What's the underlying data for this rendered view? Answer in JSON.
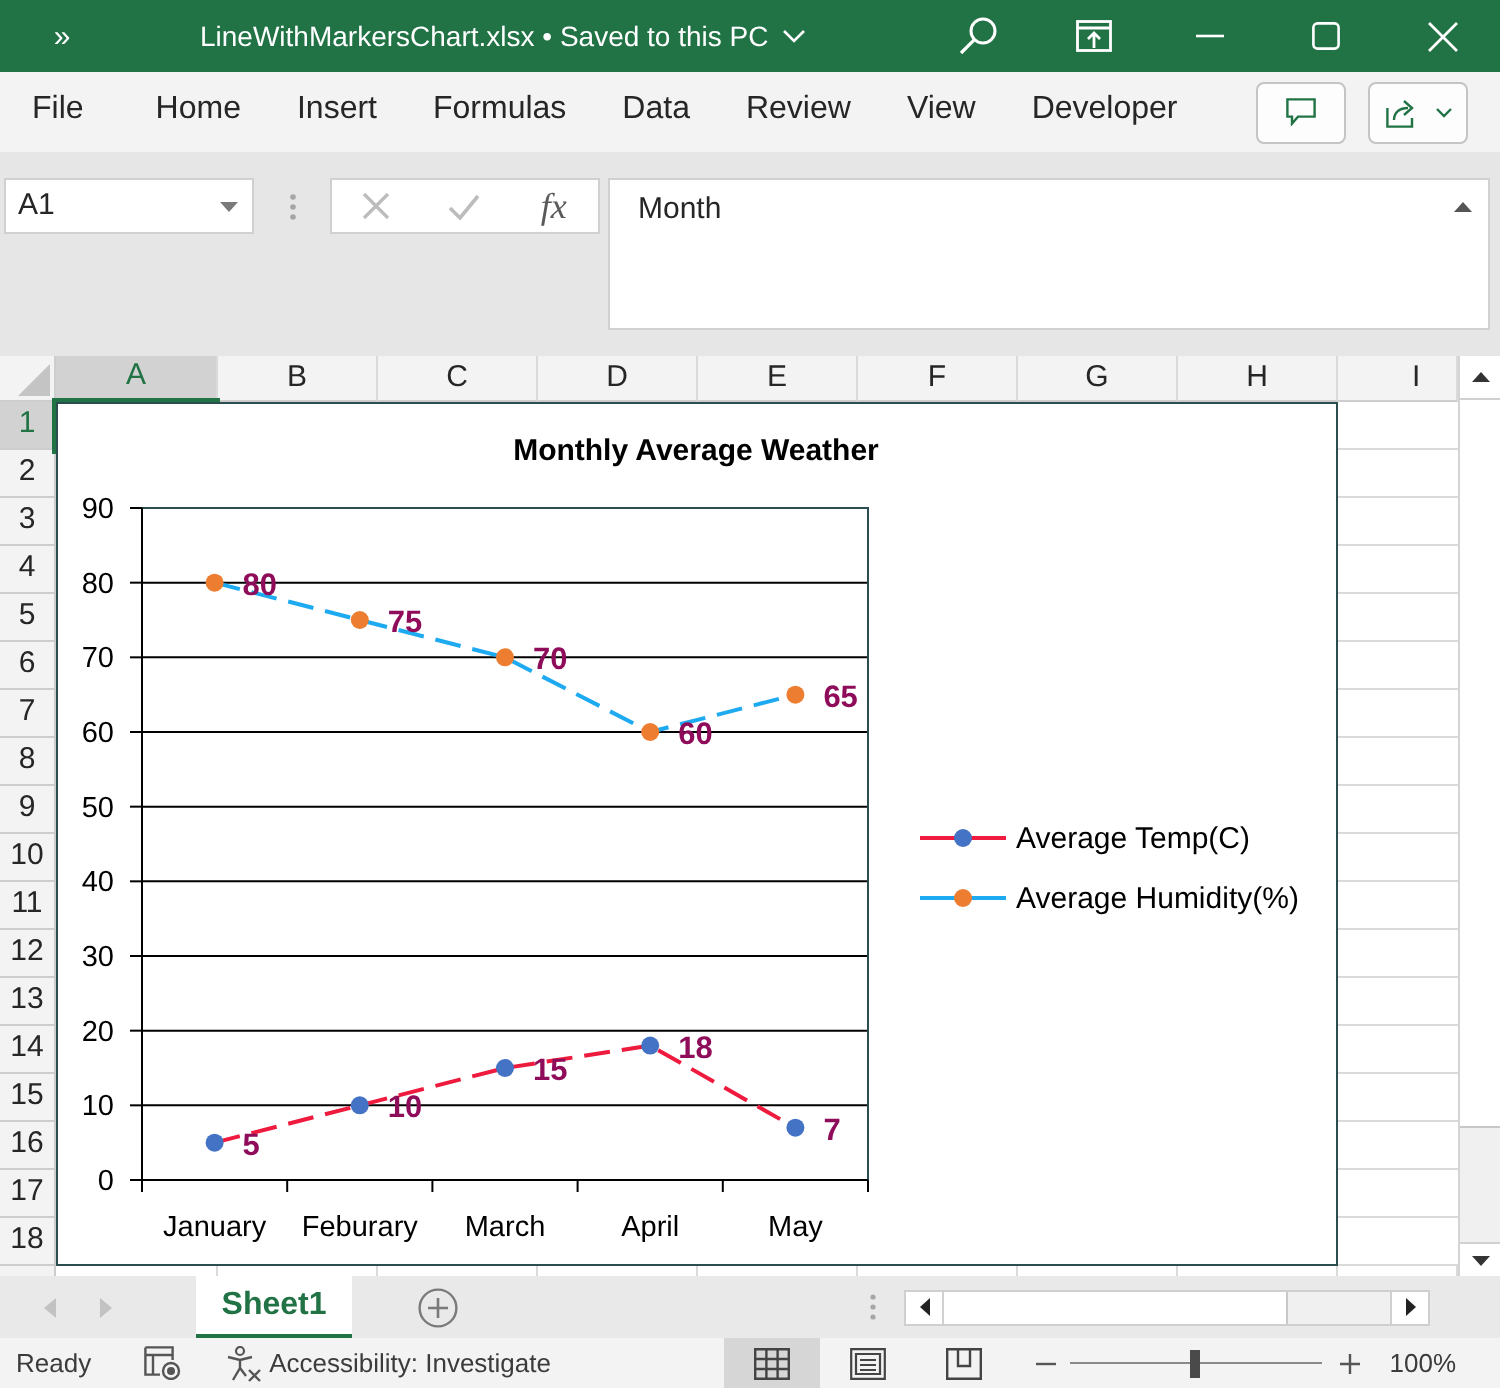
{
  "window": {
    "overflow_glyph": "»",
    "title": "LineWithMarkersChart.xlsx • Saved to this PC"
  },
  "ribbon": {
    "tabs": [
      {
        "label": "File",
        "selected": false
      },
      {
        "label": "Home",
        "selected": false
      },
      {
        "label": "Insert",
        "selected": false
      },
      {
        "label": "Formulas",
        "selected": false
      },
      {
        "label": "Data",
        "selected": false
      },
      {
        "label": "Review",
        "selected": false
      },
      {
        "label": "View",
        "selected": false
      },
      {
        "label": "Developer",
        "selected": false
      }
    ]
  },
  "formula_bar": {
    "name_box": "A1",
    "function_glyph": "fx",
    "value": "Month"
  },
  "sheet": {
    "columns": [
      {
        "label": "A",
        "selected": true
      },
      {
        "label": "B",
        "selected": false
      },
      {
        "label": "C",
        "selected": false
      },
      {
        "label": "D",
        "selected": false
      },
      {
        "label": "E",
        "selected": false
      },
      {
        "label": "F",
        "selected": false
      },
      {
        "label": "G",
        "selected": false
      },
      {
        "label": "H",
        "selected": false
      },
      {
        "label": "I",
        "selected": false
      }
    ],
    "rows": [
      {
        "label": "1",
        "selected": true
      },
      {
        "label": "2",
        "selected": false
      },
      {
        "label": "3",
        "selected": false
      },
      {
        "label": "4",
        "selected": false
      },
      {
        "label": "5",
        "selected": false
      },
      {
        "label": "6",
        "selected": false
      },
      {
        "label": "7",
        "selected": false
      },
      {
        "label": "8",
        "selected": false
      },
      {
        "label": "9",
        "selected": false
      },
      {
        "label": "10",
        "selected": false
      },
      {
        "label": "11",
        "selected": false
      },
      {
        "label": "12",
        "selected": false
      },
      {
        "label": "13",
        "selected": false
      },
      {
        "label": "14",
        "selected": false
      },
      {
        "label": "15",
        "selected": false
      },
      {
        "label": "16",
        "selected": false
      },
      {
        "label": "17",
        "selected": false
      },
      {
        "label": "18",
        "selected": false
      }
    ],
    "chart": {
      "chart_data": {
        "type": "line",
        "title": "Monthly Average Weather",
        "categories": [
          "January",
          "Feburary",
          "March",
          "April",
          "May"
        ],
        "series": [
          {
            "name": "Average Temp(C)",
            "color": "#ee1b3e",
            "line_style": "dashed",
            "marker": {
              "shape": "circle",
              "color": "#4472c4"
            },
            "values": [
              5,
              10,
              15,
              18,
              7
            ]
          },
          {
            "name": "Average Humidity(%)",
            "color": "#1eaaf1",
            "line_style": "dashed",
            "marker": {
              "shape": "circle",
              "color": "#ed7d31"
            },
            "values": [
              80,
              75,
              70,
              60,
              65
            ]
          }
        ],
        "ylim": [
          0,
          90
        ],
        "yticks": [
          0,
          10,
          20,
          30,
          40,
          50,
          60,
          70,
          80,
          90
        ],
        "grid": true,
        "legend": "right",
        "data_labels": true
      }
    }
  },
  "sheet_tabs": [
    {
      "label": "Sheet1",
      "selected": true
    }
  ],
  "status_bar": {
    "mode": "Ready",
    "accessibility": "Accessibility: Investigate",
    "views": [
      {
        "kind": "normal",
        "selected": true
      },
      {
        "kind": "page_layout",
        "selected": false
      },
      {
        "kind": "page_break",
        "selected": false
      }
    ],
    "zoom": {
      "level": 0.5,
      "reading": "100%"
    }
  }
}
